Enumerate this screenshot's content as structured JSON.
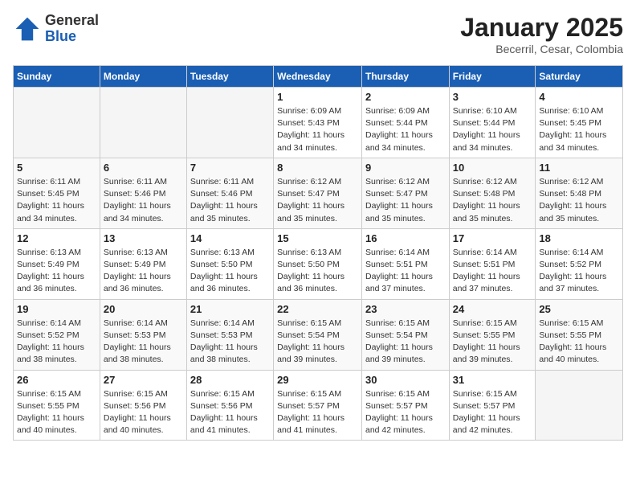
{
  "header": {
    "logo_general": "General",
    "logo_blue": "Blue",
    "cal_title": "January 2025",
    "cal_subtitle": "Becerril, Cesar, Colombia"
  },
  "days_of_week": [
    "Sunday",
    "Monday",
    "Tuesday",
    "Wednesday",
    "Thursday",
    "Friday",
    "Saturday"
  ],
  "weeks": [
    [
      {
        "day": "",
        "info": ""
      },
      {
        "day": "",
        "info": ""
      },
      {
        "day": "",
        "info": ""
      },
      {
        "day": "1",
        "info": "Sunrise: 6:09 AM\nSunset: 5:43 PM\nDaylight: 11 hours\nand 34 minutes."
      },
      {
        "day": "2",
        "info": "Sunrise: 6:09 AM\nSunset: 5:44 PM\nDaylight: 11 hours\nand 34 minutes."
      },
      {
        "day": "3",
        "info": "Sunrise: 6:10 AM\nSunset: 5:44 PM\nDaylight: 11 hours\nand 34 minutes."
      },
      {
        "day": "4",
        "info": "Sunrise: 6:10 AM\nSunset: 5:45 PM\nDaylight: 11 hours\nand 34 minutes."
      }
    ],
    [
      {
        "day": "5",
        "info": "Sunrise: 6:11 AM\nSunset: 5:45 PM\nDaylight: 11 hours\nand 34 minutes."
      },
      {
        "day": "6",
        "info": "Sunrise: 6:11 AM\nSunset: 5:46 PM\nDaylight: 11 hours\nand 34 minutes."
      },
      {
        "day": "7",
        "info": "Sunrise: 6:11 AM\nSunset: 5:46 PM\nDaylight: 11 hours\nand 35 minutes."
      },
      {
        "day": "8",
        "info": "Sunrise: 6:12 AM\nSunset: 5:47 PM\nDaylight: 11 hours\nand 35 minutes."
      },
      {
        "day": "9",
        "info": "Sunrise: 6:12 AM\nSunset: 5:47 PM\nDaylight: 11 hours\nand 35 minutes."
      },
      {
        "day": "10",
        "info": "Sunrise: 6:12 AM\nSunset: 5:48 PM\nDaylight: 11 hours\nand 35 minutes."
      },
      {
        "day": "11",
        "info": "Sunrise: 6:12 AM\nSunset: 5:48 PM\nDaylight: 11 hours\nand 35 minutes."
      }
    ],
    [
      {
        "day": "12",
        "info": "Sunrise: 6:13 AM\nSunset: 5:49 PM\nDaylight: 11 hours\nand 36 minutes."
      },
      {
        "day": "13",
        "info": "Sunrise: 6:13 AM\nSunset: 5:49 PM\nDaylight: 11 hours\nand 36 minutes."
      },
      {
        "day": "14",
        "info": "Sunrise: 6:13 AM\nSunset: 5:50 PM\nDaylight: 11 hours\nand 36 minutes."
      },
      {
        "day": "15",
        "info": "Sunrise: 6:13 AM\nSunset: 5:50 PM\nDaylight: 11 hours\nand 36 minutes."
      },
      {
        "day": "16",
        "info": "Sunrise: 6:14 AM\nSunset: 5:51 PM\nDaylight: 11 hours\nand 37 minutes."
      },
      {
        "day": "17",
        "info": "Sunrise: 6:14 AM\nSunset: 5:51 PM\nDaylight: 11 hours\nand 37 minutes."
      },
      {
        "day": "18",
        "info": "Sunrise: 6:14 AM\nSunset: 5:52 PM\nDaylight: 11 hours\nand 37 minutes."
      }
    ],
    [
      {
        "day": "19",
        "info": "Sunrise: 6:14 AM\nSunset: 5:52 PM\nDaylight: 11 hours\nand 38 minutes."
      },
      {
        "day": "20",
        "info": "Sunrise: 6:14 AM\nSunset: 5:53 PM\nDaylight: 11 hours\nand 38 minutes."
      },
      {
        "day": "21",
        "info": "Sunrise: 6:14 AM\nSunset: 5:53 PM\nDaylight: 11 hours\nand 38 minutes."
      },
      {
        "day": "22",
        "info": "Sunrise: 6:15 AM\nSunset: 5:54 PM\nDaylight: 11 hours\nand 39 minutes."
      },
      {
        "day": "23",
        "info": "Sunrise: 6:15 AM\nSunset: 5:54 PM\nDaylight: 11 hours\nand 39 minutes."
      },
      {
        "day": "24",
        "info": "Sunrise: 6:15 AM\nSunset: 5:55 PM\nDaylight: 11 hours\nand 39 minutes."
      },
      {
        "day": "25",
        "info": "Sunrise: 6:15 AM\nSunset: 5:55 PM\nDaylight: 11 hours\nand 40 minutes."
      }
    ],
    [
      {
        "day": "26",
        "info": "Sunrise: 6:15 AM\nSunset: 5:55 PM\nDaylight: 11 hours\nand 40 minutes."
      },
      {
        "day": "27",
        "info": "Sunrise: 6:15 AM\nSunset: 5:56 PM\nDaylight: 11 hours\nand 40 minutes."
      },
      {
        "day": "28",
        "info": "Sunrise: 6:15 AM\nSunset: 5:56 PM\nDaylight: 11 hours\nand 41 minutes."
      },
      {
        "day": "29",
        "info": "Sunrise: 6:15 AM\nSunset: 5:57 PM\nDaylight: 11 hours\nand 41 minutes."
      },
      {
        "day": "30",
        "info": "Sunrise: 6:15 AM\nSunset: 5:57 PM\nDaylight: 11 hours\nand 42 minutes."
      },
      {
        "day": "31",
        "info": "Sunrise: 6:15 AM\nSunset: 5:57 PM\nDaylight: 11 hours\nand 42 minutes."
      },
      {
        "day": "",
        "info": ""
      }
    ]
  ]
}
